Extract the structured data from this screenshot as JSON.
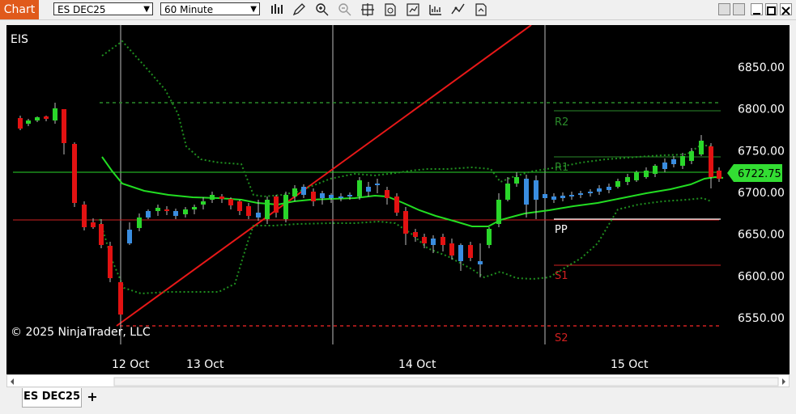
{
  "window": {
    "title": "Chart"
  },
  "toolbar": {
    "instrument": "ES DEC25",
    "interval": "60 Minute",
    "icons": [
      "bar-type-icon",
      "draw-pencil-icon",
      "zoom-in-icon",
      "zoom-out-icon",
      "crosshair-icon",
      "data-box-icon",
      "strategies-icon",
      "indicators-icon",
      "templates-icon",
      "properties-icon"
    ]
  },
  "chart": {
    "label": "EIS",
    "copyright": "© 2025 NinjaTrader, LLC",
    "current_price": "6722.75",
    "price_ticks": [
      {
        "value": 6850,
        "label": "6850.00"
      },
      {
        "value": 6800,
        "label": "6800.00"
      },
      {
        "value": 6750,
        "label": "6750.00"
      },
      {
        "value": 6700,
        "label": "6700.00"
      },
      {
        "value": 6650,
        "label": "6650.00"
      },
      {
        "value": 6600,
        "label": "6600.00"
      },
      {
        "value": 6550,
        "label": "6550.00"
      }
    ],
    "date_labels": [
      "12 Oct",
      "13 Oct",
      "14 Oct",
      "15 Oct"
    ],
    "pivot_labels": {
      "r2": "R2",
      "r1": "R1",
      "pp": "PP",
      "s1": "S1",
      "s2": "S2"
    },
    "colors": {
      "up": "#2ad62a",
      "down": "#e21212",
      "flat": "#3a8de0",
      "ma": "#22dd22",
      "bands": "#1f8f1f",
      "trend": "#e81818",
      "pivot_r": "#2a8a2a",
      "pivot_s": "#d02020",
      "pp": "#ffffff",
      "price_tag": "#33dd33"
    }
  },
  "tabs": [
    {
      "label": "ES DEC25"
    }
  ],
  "tab_add": "+"
}
